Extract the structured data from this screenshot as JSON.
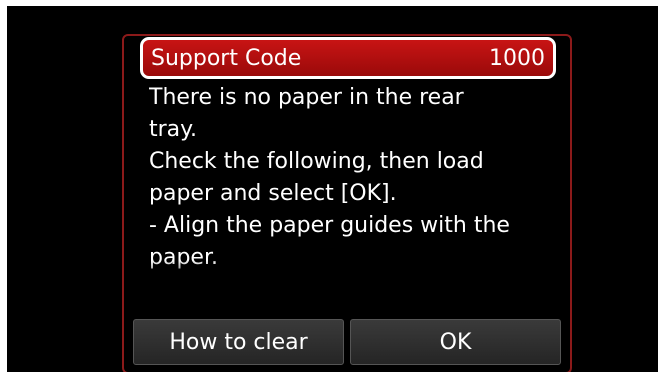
{
  "dialog": {
    "title": "Support Code",
    "code": "1000",
    "message_lines": [
      "There is no paper in the rear",
      "tray.",
      "Check the following, then load",
      "paper and select [OK].",
      "- Align the paper guides with the",
      "paper."
    ]
  },
  "buttons": {
    "how_to_clear": "How to clear",
    "ok": "OK"
  },
  "colors": {
    "header_red": "#c81414",
    "screen_bg": "#000000",
    "button_bg": "#2f2f2f"
  }
}
